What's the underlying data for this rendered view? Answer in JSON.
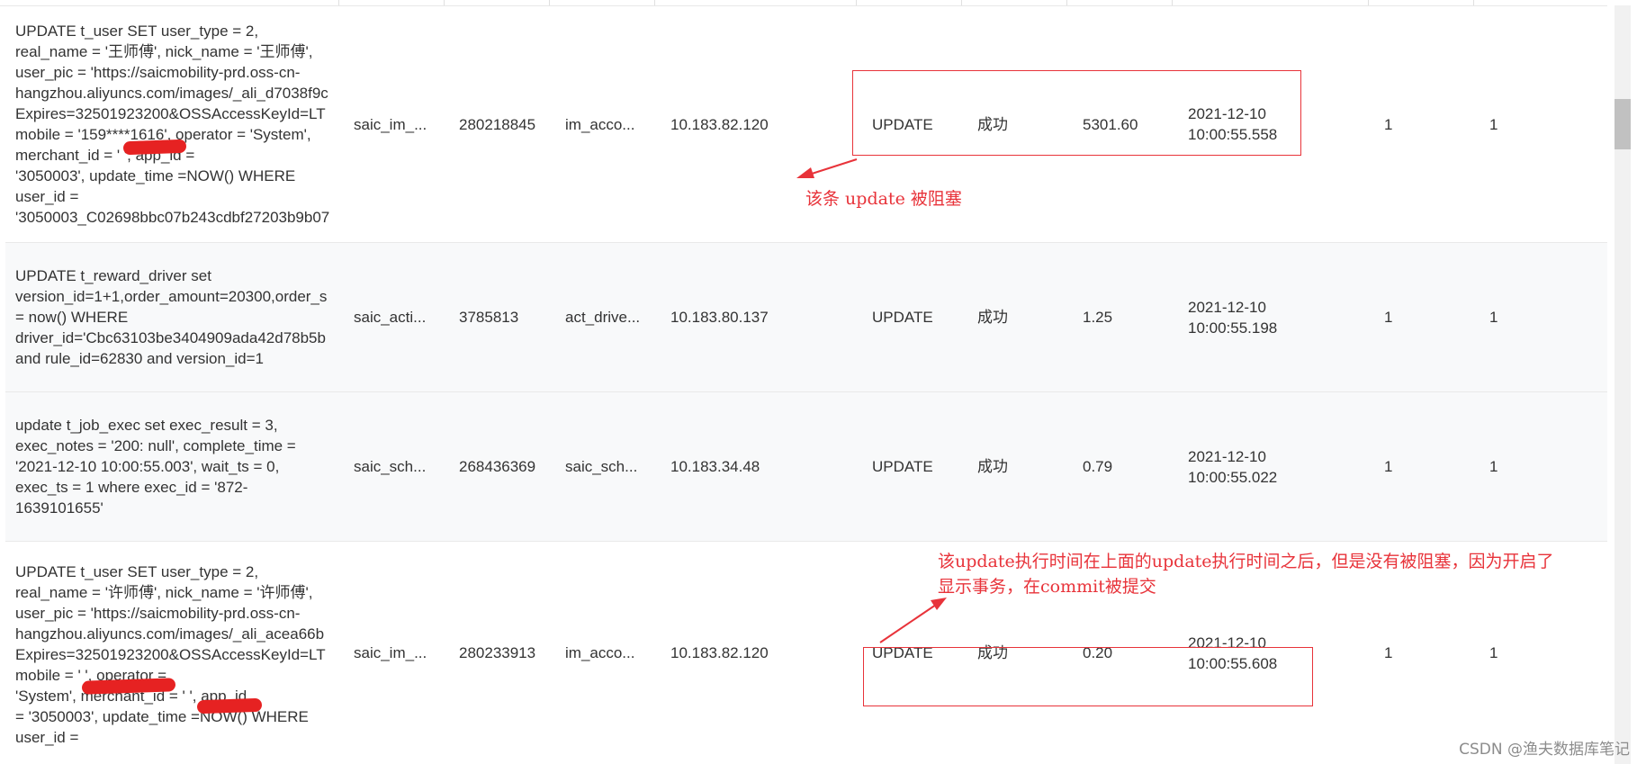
{
  "rows": [
    {
      "sql": "UPDATE t_user SET user_type = 2,\nreal_name = '王师傅', nick_name = '王师傅',\nuser_pic = 'https://saicmobility-prd.oss-cn-\nhangzhou.aliyuncs.com/images/_ali_d7038f9c\nExpires=32501923200&OSSAccessKeyId=LT\nmobile = '159****1616', operator = 'System',\nmerchant_id = '          ', app_id =\n'3050003', update_time =NOW() WHERE\nuser_id =\n'3050003_C02698bbc07b243cdbf27203b9b07",
      "db": "saic_im_...",
      "thread_id": "280218845",
      "user": "im_acco...",
      "ip": "10.183.82.120",
      "type": "UPDATE",
      "status": "成功",
      "duration": "5301.60",
      "time": "2021-12-10\n10:00:55.558",
      "n1": "1",
      "n2": "1"
    },
    {
      "sql": "UPDATE t_reward_driver set\nversion_id=1+1,order_amount=20300,order_s\n= now() WHERE\ndriver_id='Cbc63103be3404909ada42d78b5b\nand rule_id=62830 and version_id=1",
      "db": "saic_acti...",
      "thread_id": "3785813",
      "user": "act_drive...",
      "ip": "10.183.80.137",
      "type": "UPDATE",
      "status": "成功",
      "duration": "1.25",
      "time": "2021-12-10\n10:00:55.198",
      "n1": "1",
      "n2": "1"
    },
    {
      "sql": "update t_job_exec set exec_result = 3,\nexec_notes = '200: null', complete_time =\n'2021-12-10 10:00:55.003', wait_ts = 0,\nexec_ts = 1 where exec_id = '872-\n1639101655'",
      "db": "saic_sch...",
      "thread_id": "268436369",
      "user": "saic_sch...",
      "ip": "10.183.34.48",
      "type": "UPDATE",
      "status": "成功",
      "duration": "0.79",
      "time": "2021-12-10\n10:00:55.022",
      "n1": "1",
      "n2": "1"
    },
    {
      "sql": "UPDATE t_user SET user_type = 2,\nreal_name = '许师傅', nick_name = '许师傅',\nuser_pic = 'https://saicmobility-prd.oss-cn-\nhangzhou.aliyuncs.com/images/_ali_acea66b\nExpires=32501923200&OSSAccessKeyId=LT\nmobile = '              ', operator =\n'System', merchant_id = '           ', app_id\n= '3050003', update_time =NOW() WHERE\nuser_id =",
      "db": "saic_im_...",
      "thread_id": "280233913",
      "user": "im_acco...",
      "ip": "10.183.82.120",
      "type": "UPDATE",
      "status": "成功",
      "duration": "0.20",
      "time": "2021-12-10\n10:00:55.608",
      "n1": "1",
      "n2": "1"
    }
  ],
  "annotations": {
    "blocked_note": "该条 update 被阻塞",
    "explain_line1": "该update执行时间在上面的update执行时间之后，但是没有被阻塞，因为开启了",
    "explain_line2": "显示事务，在commit被提交",
    "color": "#e8333a"
  },
  "watermark": "CSDN @渔夫数据库笔记",
  "colors": {
    "row_even": "#f8f9fa",
    "row_odd": "#ffffff",
    "redaction": "#e62222"
  }
}
